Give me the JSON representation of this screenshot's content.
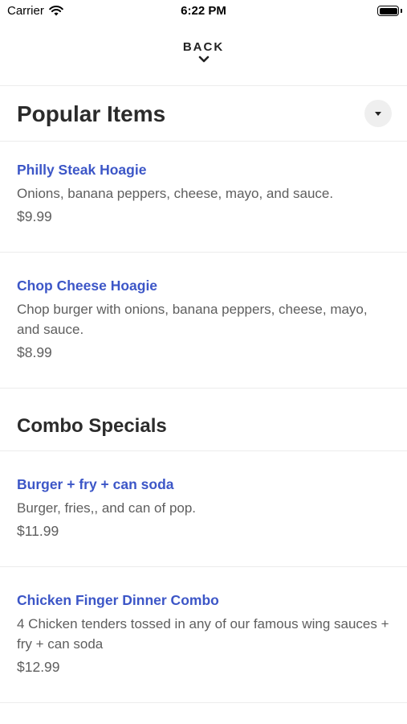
{
  "status_bar": {
    "carrier": "Carrier",
    "time": "6:22 PM",
    "wifi_icon": "wifi-icon",
    "battery_icon": "battery-icon"
  },
  "nav": {
    "back_label": "BACK",
    "back_icon": "chevron-down-icon"
  },
  "sections": {
    "popular": {
      "title": "Popular Items",
      "toggle_icon": "caret-down-icon",
      "items": [
        {
          "name": "Philly Steak Hoagie",
          "description": "Onions, banana peppers, cheese, mayo, and sauce.",
          "price": "$9.99"
        },
        {
          "name": "Chop Cheese Hoagie",
          "description": "Chop burger with onions, banana peppers, cheese, mayo, and sauce.",
          "price": "$8.99"
        }
      ]
    },
    "combo": {
      "title": "Combo Specials",
      "items": [
        {
          "name": "Burger + fry + can soda",
          "description": "Burger, fries,, and can of pop.",
          "price": "$11.99"
        },
        {
          "name": "Chicken Finger Dinner Combo",
          "description": "4 Chicken tenders tossed in any of our famous wing sauces + fry + can soda",
          "price": "$12.99"
        }
      ]
    }
  },
  "colors": {
    "item_name": "#3c56c7",
    "text_secondary": "#5e5e5e",
    "title": "#2b2b2b",
    "divider": "#ececec"
  }
}
